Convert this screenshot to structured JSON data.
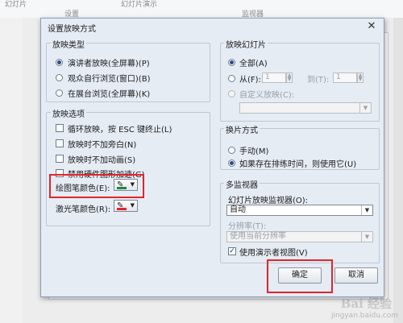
{
  "background": {
    "ribbon_items": [
      "幻灯片",
      "幻灯片演示",
      "设置",
      "监视器"
    ],
    "watermark": "jingyan.baidu.com",
    "watermark_logo": "Bai 经验"
  },
  "dialog": {
    "title": "设置放映方式",
    "close_symbol": "✕",
    "show_type": {
      "label": "放映类型",
      "options": [
        "演讲者放映(全屏幕)(P)",
        "观众自行浏览(窗口)(B)",
        "在展台浏览(全屏幕)(K)"
      ],
      "selected": 0
    },
    "show_options": {
      "label": "放映选项",
      "checkboxes": [
        "循环放映，按 ESC 键终止(L)",
        "放映时不加旁白(N)",
        "放映时不加动画(S)",
        "禁用硬件图形加速(G)"
      ],
      "pen_color_label": "绘图笔颜色(E):",
      "laser_color_label": "激光笔颜色(R):",
      "pen_color": "#1f8a3c",
      "laser_color": "#e0252d"
    },
    "slides": {
      "label": "放映幻灯片",
      "all_label": "全部(A)",
      "from_label": "从(F):",
      "from_value": "1",
      "to_label": "到(T):",
      "to_value": "1",
      "custom_label": "自定义放映(C):"
    },
    "advance": {
      "label": "换片方式",
      "options": [
        "手动(M)",
        "如果存在排练时间，则使用它(U)"
      ],
      "selected": 1
    },
    "monitors": {
      "label": "多监视器",
      "monitor_label": "幻灯片放映监视器(O):",
      "monitor_value": "自动",
      "resolution_label": "分辨率(T):",
      "resolution_value": "使用当前分辨率",
      "presenter_view_label": "使用演示者视图(V)"
    },
    "ok_label": "确定",
    "cancel_label": "取消"
  },
  "colors": {
    "highlight": "#e0252d",
    "dialog_bg": "#e6ecf4"
  }
}
